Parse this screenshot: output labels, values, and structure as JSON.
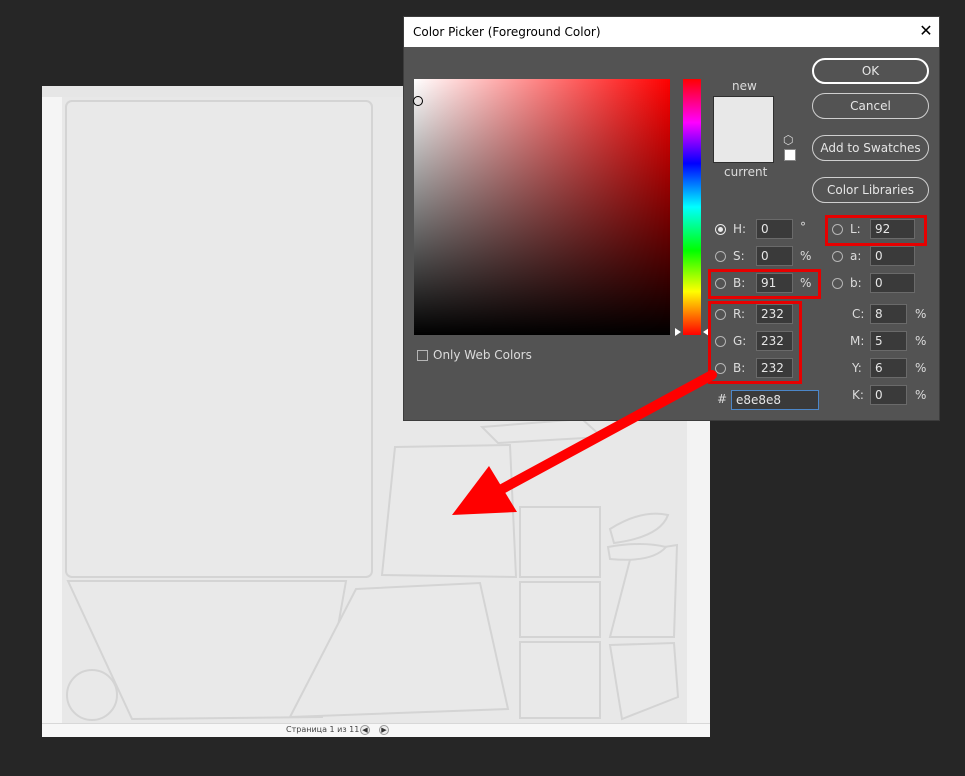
{
  "document": {
    "pager_text": "Страница 1 из 11",
    "prev_icon": "◀",
    "next_icon": "▶"
  },
  "dialog": {
    "title": "Color Picker (Foreground Color)",
    "close_icon": "✕",
    "swatch": {
      "new_label": "new",
      "current_label": "current",
      "color": "#e8e8e8"
    },
    "buttons": {
      "ok": "OK",
      "cancel": "Cancel",
      "add_to_swatches": "Add to Swatches",
      "color_libraries": "Color Libraries"
    },
    "only_web_colors": "Only Web Colors",
    "hsb": {
      "h": {
        "label": "H:",
        "value": "0",
        "unit": "°"
      },
      "s": {
        "label": "S:",
        "value": "0",
        "unit": "%"
      },
      "b": {
        "label": "B:",
        "value": "91",
        "unit": "%"
      }
    },
    "rgb": {
      "r": {
        "label": "R:",
        "value": "232"
      },
      "g": {
        "label": "G:",
        "value": "232"
      },
      "b": {
        "label": "B:",
        "value": "232"
      }
    },
    "lab": {
      "l": {
        "label": "L:",
        "value": "92"
      },
      "a": {
        "label": "a:",
        "value": "0"
      },
      "b": {
        "label": "b:",
        "value": "0"
      }
    },
    "cmyk": {
      "c": {
        "label": "C:",
        "value": "8",
        "unit": "%"
      },
      "m": {
        "label": "M:",
        "value": "5",
        "unit": "%"
      },
      "y": {
        "label": "Y:",
        "value": "6",
        "unit": "%"
      },
      "k": {
        "label": "K:",
        "value": "0",
        "unit": "%"
      }
    },
    "hex": {
      "label": "#",
      "value": "e8e8e8"
    }
  },
  "colors": {
    "highlight": "#e60000",
    "dialog_bg": "#535353",
    "canvas": "#e8e8e8"
  }
}
